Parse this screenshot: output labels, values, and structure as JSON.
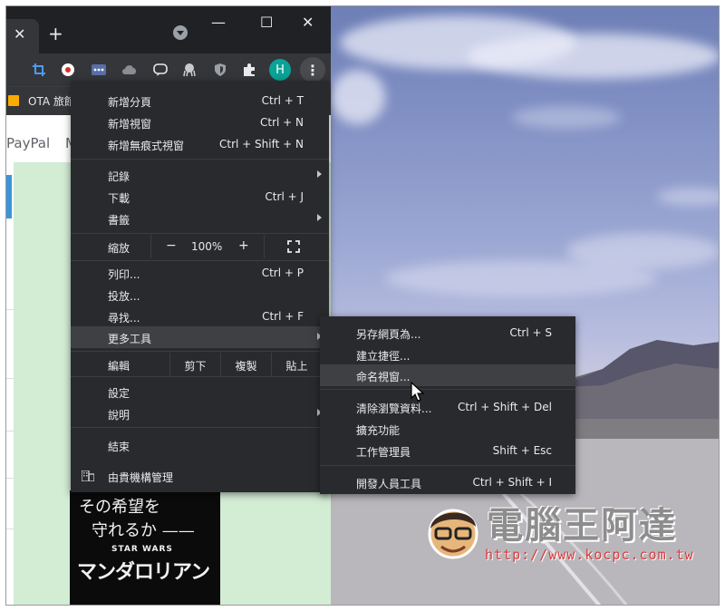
{
  "browser": {
    "tab_close": "✕",
    "new_tab": "+",
    "window_controls": {
      "minimize": "—",
      "maximize": "☐",
      "close": "✕"
    },
    "extensions": [
      "crop-icon",
      "record-icon",
      "dots-icon",
      "cloud-icon",
      "chat-icon",
      "octopus-icon",
      "shield-icon",
      "puzzle-icon"
    ],
    "profile_initial": "H",
    "profile_color": "#0aa397",
    "menu_button": "⋮",
    "bookmark": "OTA 旅館",
    "page_tabs": [
      "PayPal",
      "M"
    ]
  },
  "poster": {
    "line1": "その希望を",
    "line2": "守れるか ——",
    "brand": "STAR WARS",
    "title": "マンダロリアン"
  },
  "menu": {
    "group1": [
      {
        "label": "新增分頁",
        "shortcut": "Ctrl + T"
      },
      {
        "label": "新增視窗",
        "shortcut": "Ctrl + N"
      },
      {
        "label": "新增無痕式視窗",
        "shortcut": "Ctrl + Shift + N"
      }
    ],
    "group2": [
      {
        "label": "記錄",
        "shortcut": ""
      },
      {
        "label": "下載",
        "shortcut": "Ctrl + J"
      },
      {
        "label": "書籤",
        "shortcut": ""
      }
    ],
    "zoom": {
      "label": "縮放",
      "minus": "−",
      "value": "100%",
      "plus": "+"
    },
    "group3": [
      {
        "label": "列印...",
        "shortcut": "Ctrl + P"
      },
      {
        "label": "投放...",
        "shortcut": ""
      },
      {
        "label": "尋找...",
        "shortcut": "Ctrl + F"
      },
      {
        "label": "更多工具",
        "shortcut": ""
      }
    ],
    "edit": {
      "label": "編輯",
      "cut": "剪下",
      "copy": "複製",
      "paste": "貼上"
    },
    "group4": [
      {
        "label": "設定",
        "shortcut": ""
      },
      {
        "label": "說明",
        "shortcut": ""
      }
    ],
    "exit": "結束",
    "managed": "由貴機構管理"
  },
  "submenu": {
    "items": [
      {
        "label": "另存網頁為...",
        "shortcut": "Ctrl + S"
      },
      {
        "label": "建立捷徑...",
        "shortcut": ""
      },
      {
        "label": "命名視窗...",
        "shortcut": ""
      },
      {
        "label": "清除瀏覽資料...",
        "shortcut": "Ctrl + Shift + Del"
      },
      {
        "label": "擴充功能",
        "shortcut": ""
      },
      {
        "label": "工作管理員",
        "shortcut": "Shift + Esc"
      },
      {
        "label": "開發人員工具",
        "shortcut": "Ctrl + Shift + I"
      }
    ]
  },
  "watermark": {
    "title": "電腦王阿達",
    "url": "http://www.kocpc.com.tw"
  },
  "colors": {
    "menu_bg": "#292a2d",
    "menu_highlight": "#3f4043",
    "titlebar": "#202124",
    "toolbar": "#35363a",
    "page_green": "#d3ecd4",
    "watermark_red": "#d83a3a"
  }
}
